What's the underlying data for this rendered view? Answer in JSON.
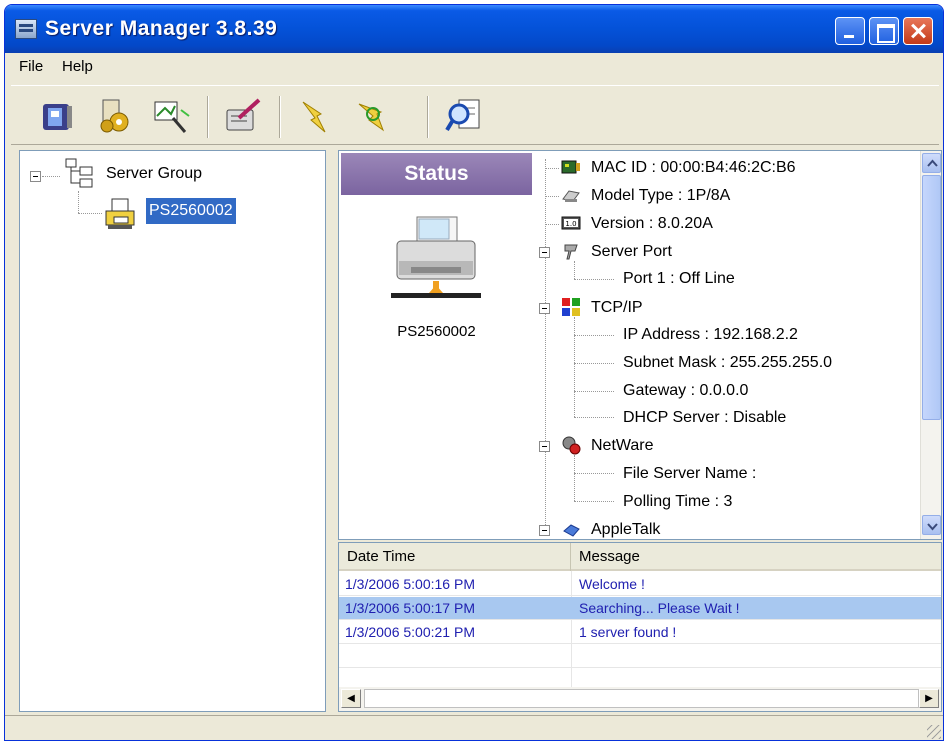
{
  "window": {
    "title": "Server Manager 3.8.39"
  },
  "menu": {
    "file": "File",
    "help": "Help"
  },
  "toolbar": {
    "buttons": [
      "server-props-icon",
      "settings-gears-icon",
      "search-devices-icon",
      "edit-config-icon",
      "connect-icon",
      "disconnect-icon",
      "find-server-icon"
    ]
  },
  "server_tree": {
    "root_label": "Server Group",
    "selected_server": "PS2560002"
  },
  "status_panel": {
    "header": "Status",
    "device_label": "PS2560002"
  },
  "details": {
    "mac_id": "MAC ID : 00:00:B4:46:2C:B6",
    "model_type": "Model Type : 1P/8A",
    "version": "Version : 8.0.20A",
    "server_port": "Server Port",
    "port1": "Port 1 : Off Line",
    "tcpip": "TCP/IP",
    "ip_address": "IP Address : 192.168.2.2",
    "subnet_mask": "Subnet Mask : 255.255.255.0",
    "gateway": "Gateway : 0.0.0.0",
    "dhcp_server": "DHCP Server : Disable",
    "netware": "NetWare",
    "file_server_name": "File Server Name :",
    "polling_time": "Polling Time : 3",
    "appletalk": "AppleTalk"
  },
  "log": {
    "col_datetime": "Date Time",
    "col_message": "Message",
    "rows": [
      {
        "datetime": "1/3/2006 5:00:16 PM",
        "message": "Welcome !"
      },
      {
        "datetime": "1/3/2006 5:00:17 PM",
        "message": "Searching... Please Wait !"
      },
      {
        "datetime": "1/3/2006 5:00:21 PM",
        "message": "1 server found !"
      }
    ],
    "selected_row": 2
  },
  "colors": {
    "title_bar": "#0452d8",
    "status_header": "#8a74ac",
    "selection": "#316ac5",
    "log_text": "#2020b0"
  }
}
